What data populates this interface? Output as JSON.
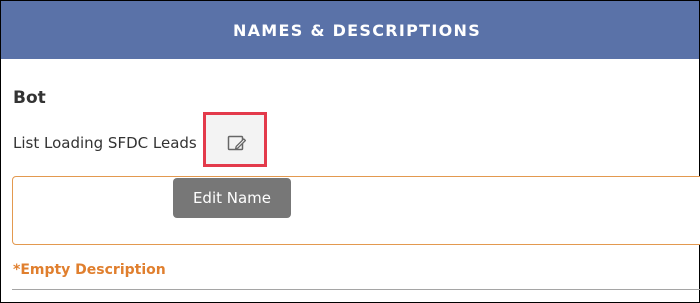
{
  "header": {
    "title": "NAMES & DESCRIPTIONS"
  },
  "section": {
    "title": "Bot"
  },
  "bot": {
    "name": "List Loading SFDC Leads",
    "edit_tooltip": "Edit Name",
    "description_status": "*Empty Description"
  },
  "colors": {
    "header_bg": "#5a72a8",
    "highlight_border": "#e33a4b",
    "description_border": "#e3994f",
    "empty_description_text": "#e07f2e",
    "tooltip_bg": "#777777"
  },
  "icons": {
    "edit_name": "edit-square-icon"
  }
}
